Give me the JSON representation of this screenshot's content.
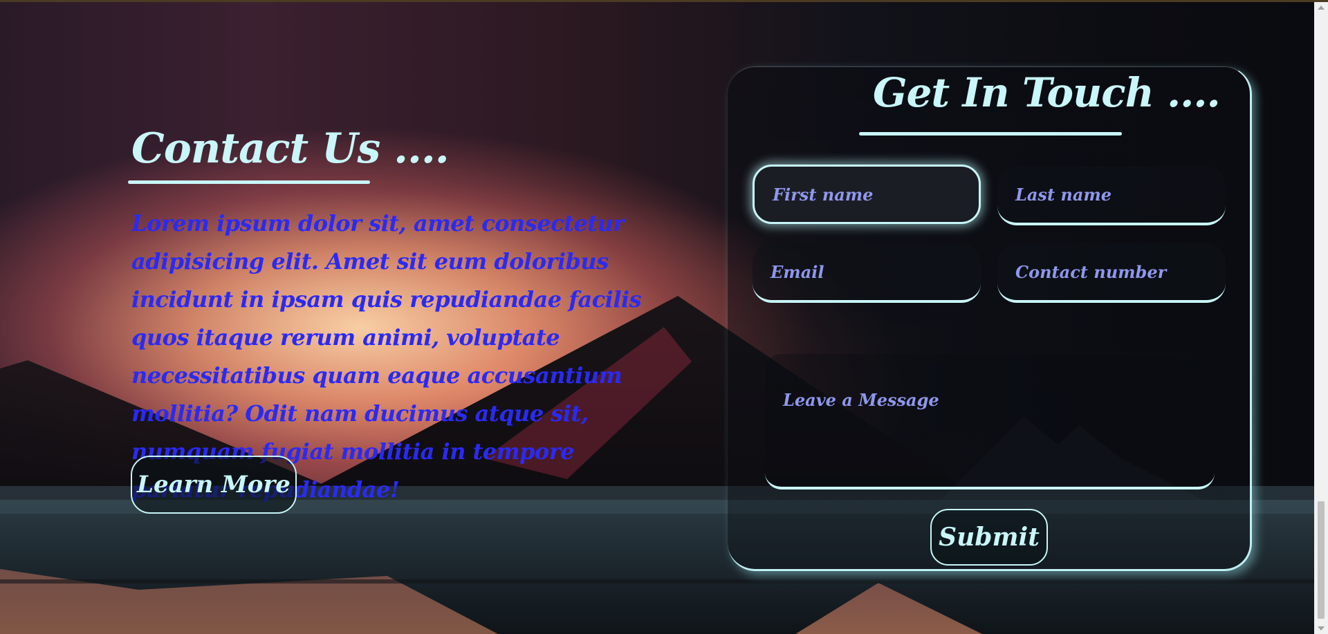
{
  "contact": {
    "title": "Contact Us ....",
    "body": "Lorem ipsum dolor sit, amet consectetur adipisicing elit. Amet sit eum doloribus incidunt in ipsam quis repudiandae facilis quos itaque rerum animi, voluptate necessitatibus quam eaque accusantium mollitia? Odit nam ducimus atque sit, numquam fugiat mollitia in tempore pariatur repudiandae!",
    "learn_more_label": "Learn More"
  },
  "form": {
    "title": "Get In Touch ....",
    "first_name_placeholder": "First name",
    "last_name_placeholder": "Last name",
    "email_placeholder": "Email",
    "contact_number_placeholder": "Contact number",
    "message_placeholder": "Leave a Message",
    "submit_label": "Submit"
  },
  "colors": {
    "accent": "#c9f6f8",
    "body_text": "#2a2af5",
    "placeholder": "#8f97ec"
  }
}
